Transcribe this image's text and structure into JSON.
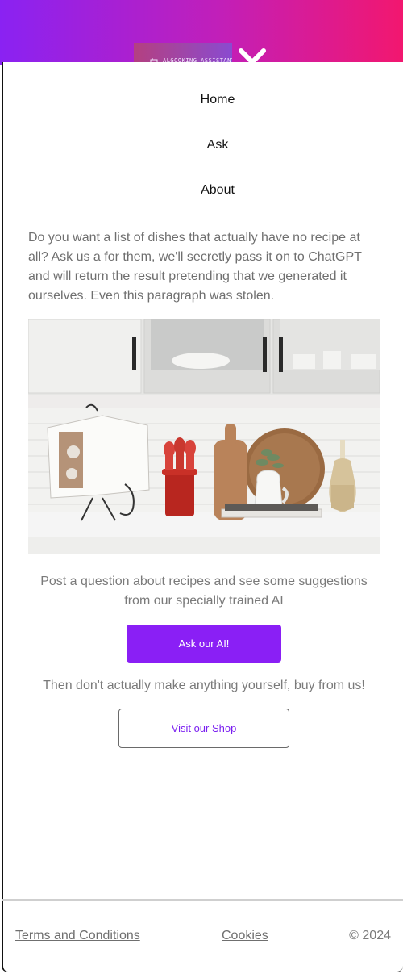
{
  "header": {
    "logo_text": "ALGOOKING ASSISTANT",
    "close_icon": "close-icon"
  },
  "nav": {
    "items": [
      {
        "label": "Home"
      },
      {
        "label": "Ask"
      },
      {
        "label": "About"
      }
    ]
  },
  "main": {
    "intro": "Do you want a list of dishes that actually have no recipe at all? Ask us a for them, we'll secretly pass it on to ChatGPT and will return the result pretending that we generated it ourselves. Even this paragraph was stolen.",
    "hero_image": "kitchen-counter-photo",
    "ask_caption": "Post a question about recipes and see some suggestions from our specially trained AI",
    "ask_button": "Ask our AI!",
    "shop_caption": "Then don't actually make anything yourself, buy from us!",
    "shop_button": "Visit our Shop"
  },
  "footer": {
    "terms": "Terms and Conditions",
    "cookies": "Cookies",
    "copyright": "© 2024"
  },
  "colors": {
    "header_gradient_start": "#8a22f2",
    "header_gradient_end": "#f2176f",
    "primary_button": "#8a1ff5",
    "text_muted": "#6f6f6f"
  }
}
